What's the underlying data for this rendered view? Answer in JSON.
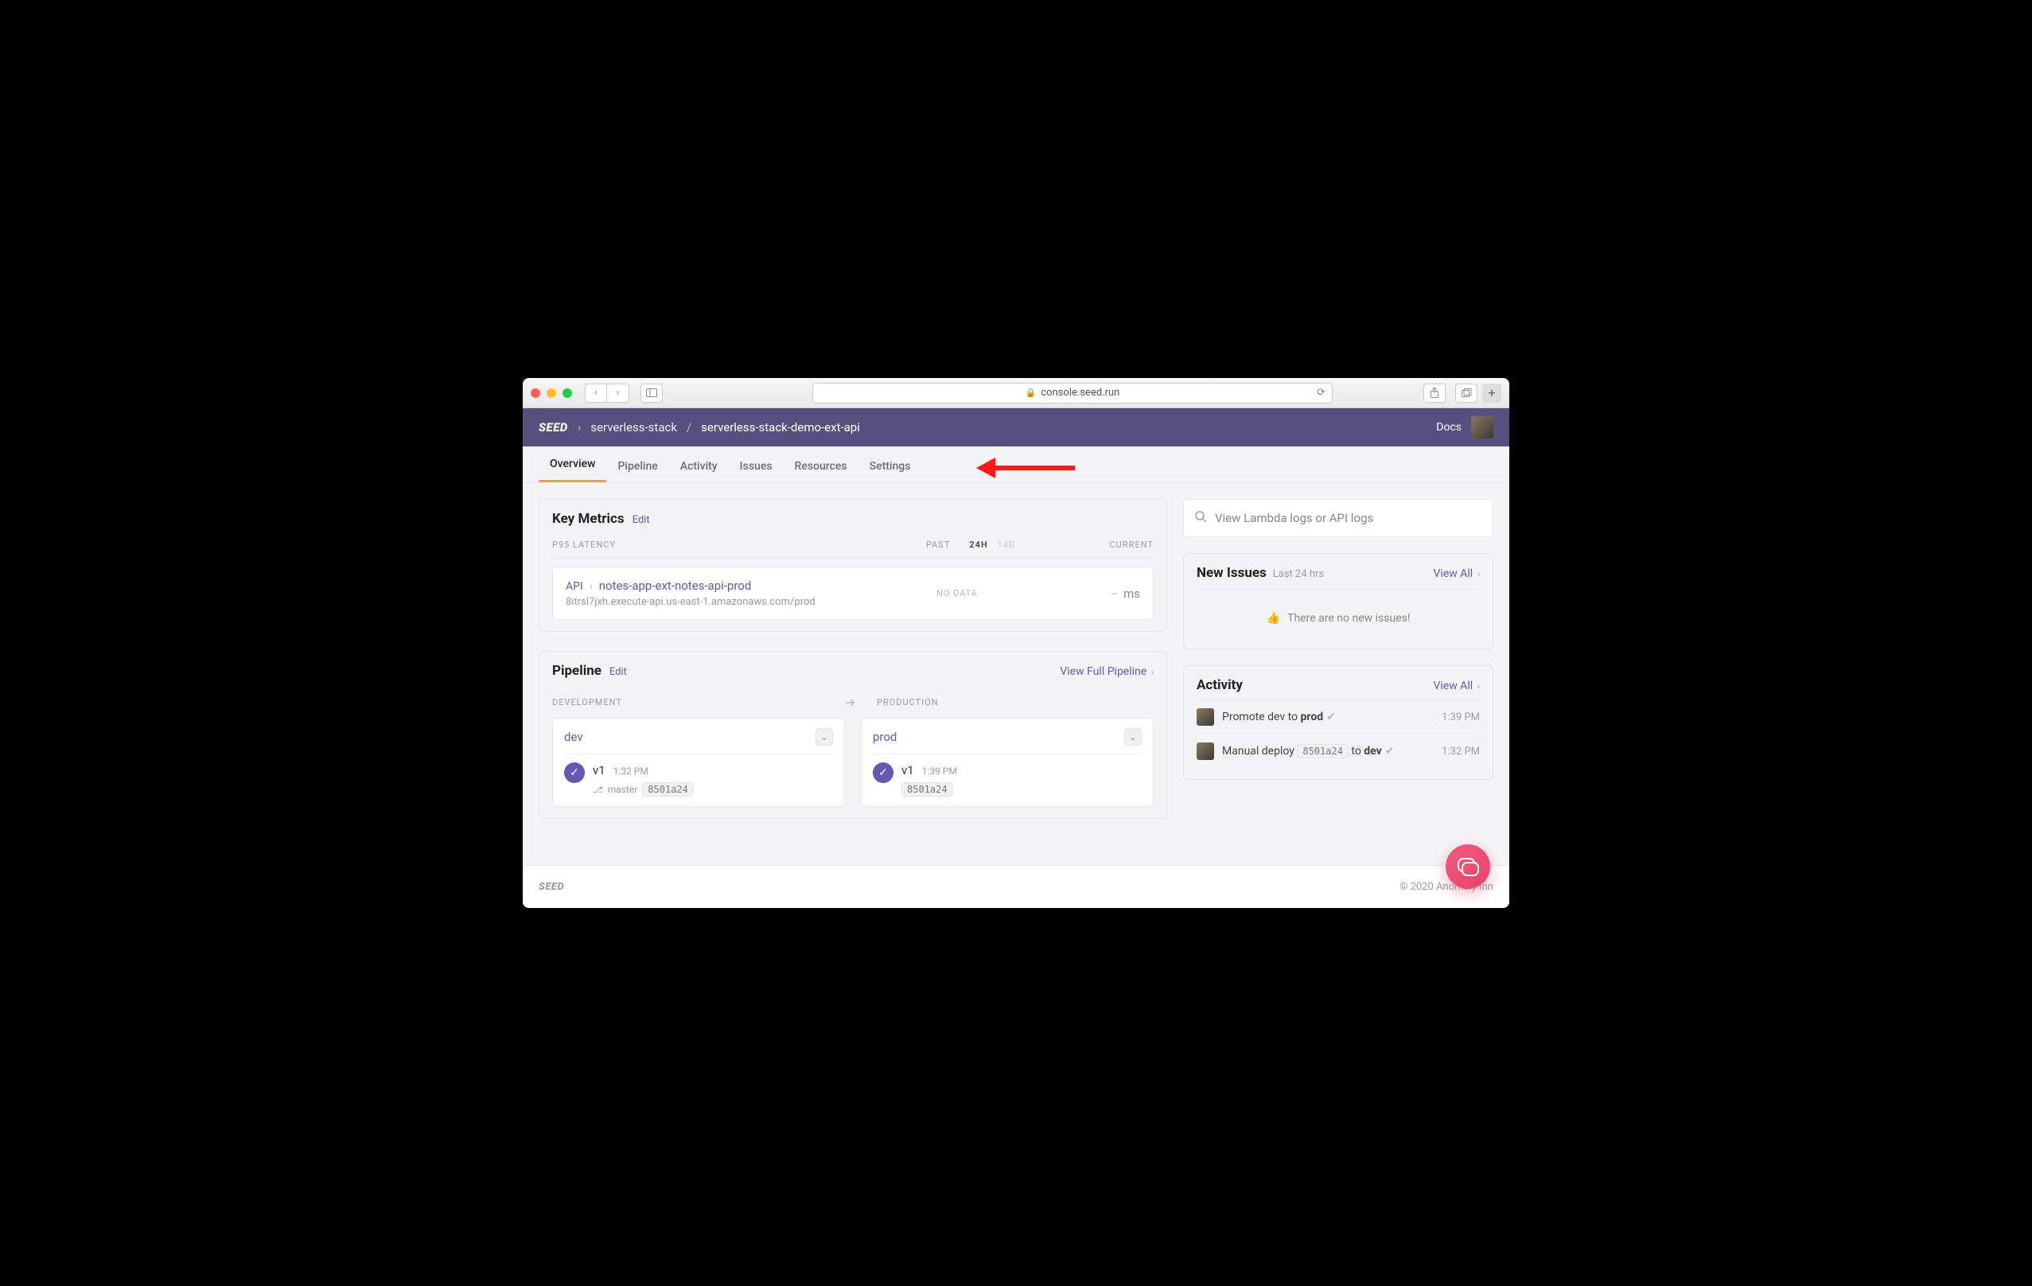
{
  "browser": {
    "url": "console.seed.run"
  },
  "header": {
    "logo": "SEED",
    "breadcrumb": {
      "org": "serverless-stack",
      "project": "serverless-stack-demo-ext-api"
    },
    "docs": "Docs"
  },
  "tabs": {
    "overview": "Overview",
    "pipeline": "Pipeline",
    "activity": "Activity",
    "issues": "Issues",
    "resources": "Resources",
    "settings": "Settings"
  },
  "metrics": {
    "title": "Key Metrics",
    "edit": "Edit",
    "labels": {
      "latency": "P95 LATENCY",
      "past": "PAST",
      "h24": "24H",
      "d14": "14D",
      "current": "CURRENT"
    },
    "item": {
      "api_label": "API",
      "name": "notes-app-ext-notes-api-prod",
      "endpoint": "8itrsl7jxh.execute-api.us-east-1.amazonaws.com/prod",
      "no_data": "NO DATA",
      "unit": "ms"
    }
  },
  "pipeline": {
    "title": "Pipeline",
    "edit": "Edit",
    "view_full": "View Full Pipeline",
    "labels": {
      "dev": "DEVELOPMENT",
      "prod": "PRODUCTION"
    },
    "dev": {
      "name": "dev",
      "version": "v1",
      "time": "1:32 PM",
      "branch": "master",
      "sha": "8501a24"
    },
    "prod": {
      "name": "prod",
      "version": "v1",
      "time": "1:39 PM",
      "sha": "8501a24"
    }
  },
  "search": {
    "placeholder": "View Lambda logs or API logs"
  },
  "issues": {
    "title": "New Issues",
    "subtitle": "Last 24 hrs",
    "view_all": "View All",
    "empty": "There are no new issues!"
  },
  "activity": {
    "title": "Activity",
    "view_all": "View All",
    "rows": [
      {
        "prefix": "Promote dev to ",
        "bold": "prod",
        "suffix": "",
        "time": "1:39 PM"
      },
      {
        "prefix": "Manual deploy ",
        "sha": "8501a24",
        "mid": " to ",
        "bold": "dev",
        "time": "1:32 PM"
      }
    ]
  },
  "footer": {
    "logo": "SEED",
    "copyright": "© 2020 Anomaly Inn"
  }
}
